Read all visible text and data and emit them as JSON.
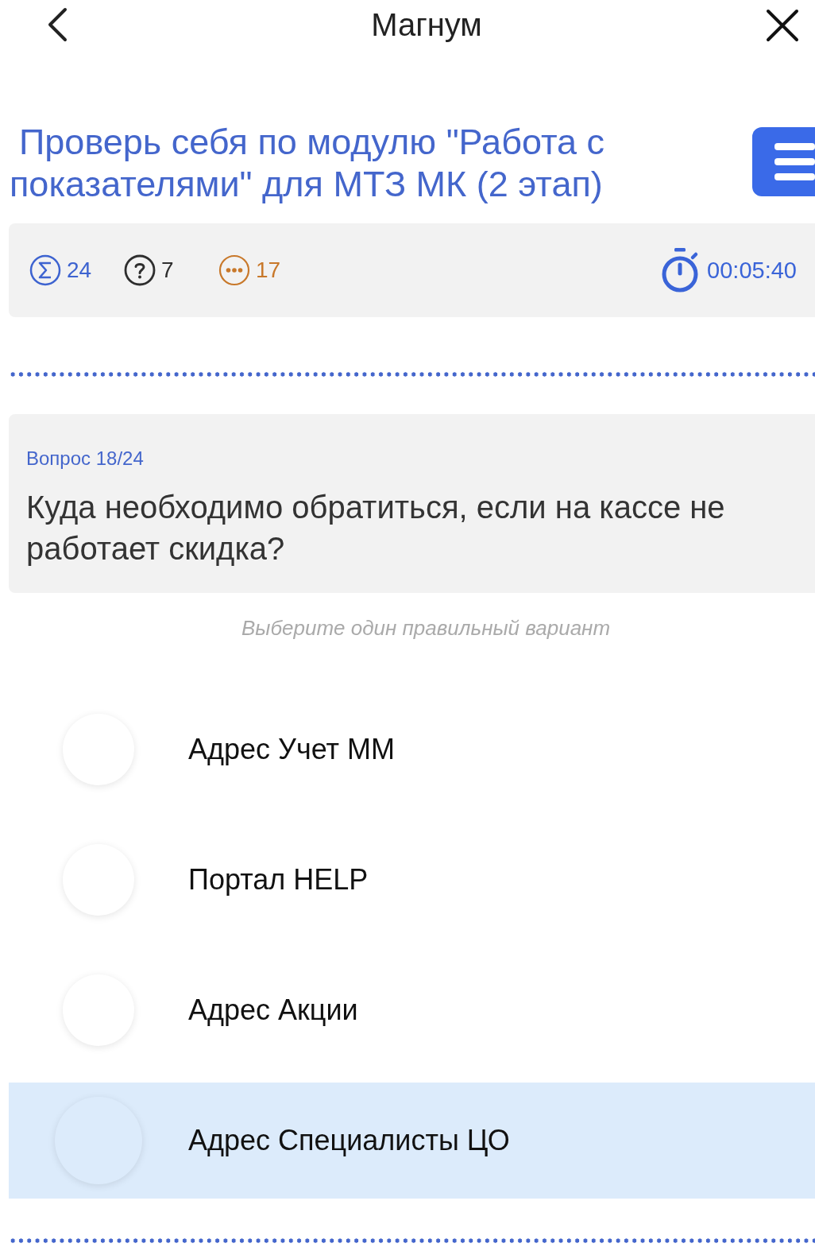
{
  "app_bar": {
    "title": "Магнум"
  },
  "test_title": "Проверь себя по модулю \"Работа с показателями\" для МТЗ МК (2 этап)",
  "stats": [
    {
      "kind": "sum",
      "value": "24",
      "color": "#3d63d0"
    },
    {
      "kind": "question",
      "value": "7",
      "color": "#2e2e2e"
    },
    {
      "kind": "dots",
      "value": "17",
      "color": "#c8782a"
    }
  ],
  "timer": "00:05:40",
  "question": {
    "counter": "Вопрос 18/24",
    "text": "Куда необходимо обратиться, если на кассе не работает скидка?"
  },
  "hint": "Выберите один правильный вариант",
  "options": [
    {
      "label": "Адрес Учет ММ",
      "selected": false
    },
    {
      "label": "Портал HELP",
      "selected": false
    },
    {
      "label": "Адрес Акции",
      "selected": false
    },
    {
      "label": "Адрес Специалисты ЦО",
      "selected": true
    }
  ]
}
